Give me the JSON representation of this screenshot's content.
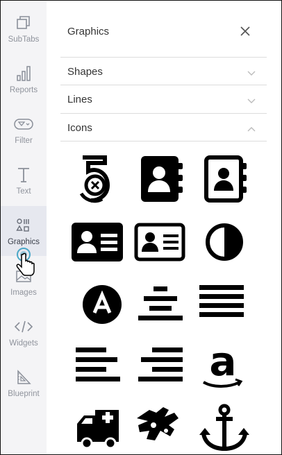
{
  "sidebar": {
    "items": [
      {
        "label": "SubTabs"
      },
      {
        "label": "Reports"
      },
      {
        "label": "Filter"
      },
      {
        "label": "Text"
      },
      {
        "label": "Graphics"
      },
      {
        "label": "Images"
      },
      {
        "label": "Widgets"
      },
      {
        "label": "Blueprint"
      }
    ],
    "active_index": 4
  },
  "panel": {
    "title": "Graphics",
    "sections": [
      {
        "label": "Shapes",
        "state": "collapsed"
      },
      {
        "label": "Lines",
        "state": "collapsed"
      },
      {
        "label": "Icons",
        "state": "expanded"
      }
    ]
  },
  "icons": [
    {
      "name": "500px-icon",
      "glyph": "5"
    },
    {
      "name": "address-book-icon"
    },
    {
      "name": "address-book-outline-icon"
    },
    {
      "name": "address-card-icon"
    },
    {
      "name": "address-card-outline-icon"
    },
    {
      "name": "adjust-icon"
    },
    {
      "name": "angellist-icon"
    },
    {
      "name": "align-center-icon"
    },
    {
      "name": "align-justify-icon"
    },
    {
      "name": "align-left-icon"
    },
    {
      "name": "align-right-icon"
    },
    {
      "name": "amazon-icon",
      "glyph": "a"
    },
    {
      "name": "ambulance-icon"
    },
    {
      "name": "sign-language-icon"
    },
    {
      "name": "anchor-icon"
    }
  ],
  "colors": {
    "sidebar_bg": "#f4f4f6",
    "active_bg": "#e6e8ef",
    "icon": "#000000",
    "cursor": "#4aa8c8"
  }
}
